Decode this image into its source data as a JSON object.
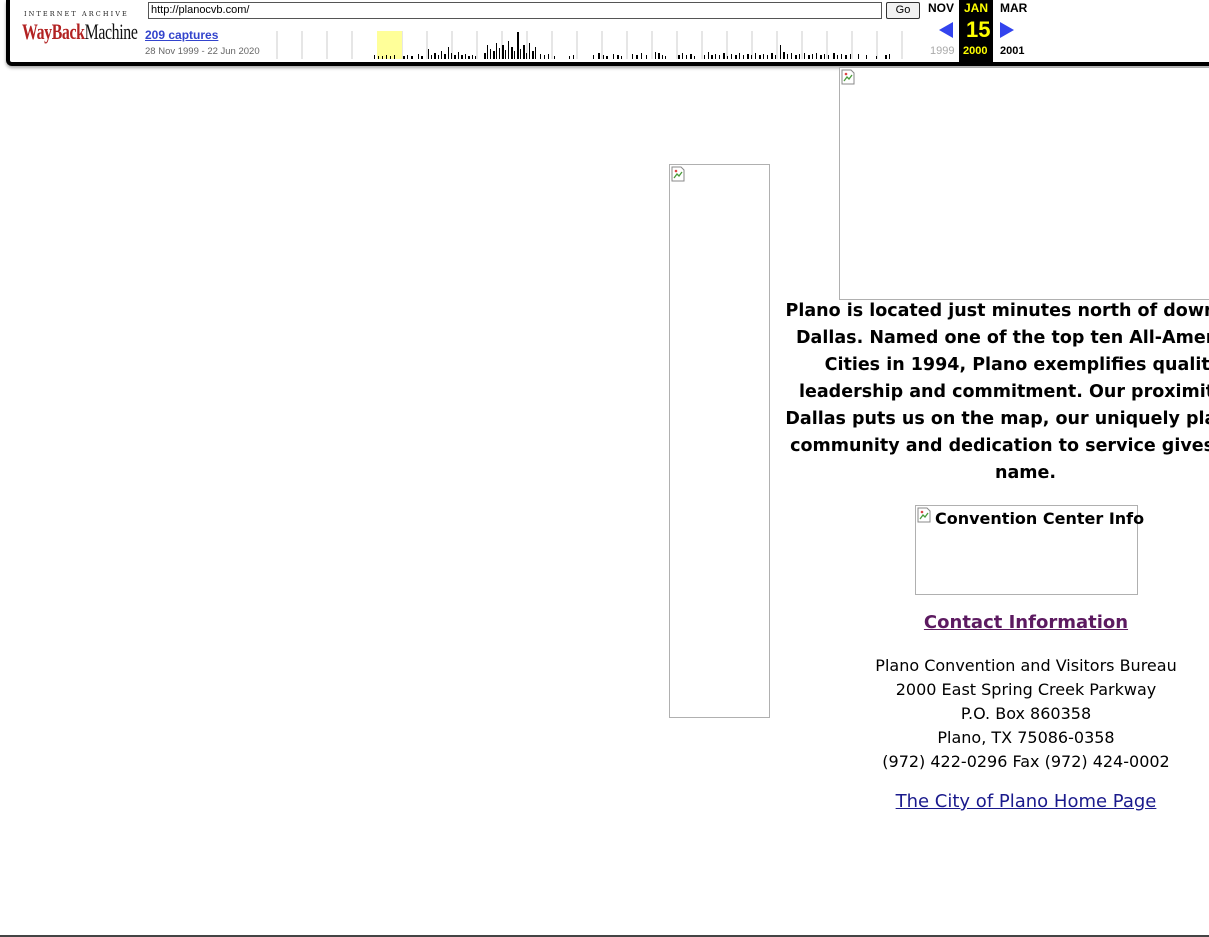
{
  "toolbar": {
    "logo_top": "INTERNET ARCHIVE",
    "logo_wayback_red": "WayBack",
    "logo_wayback_black": "Machine",
    "url_value": "http://planocvb.com/",
    "go_label": "Go",
    "captures_label": "209 captures",
    "date_range": "28 Nov 1999 - 22 Jun 2020",
    "prev_month": "NOV",
    "current_month": "JAN",
    "next_month": "MAR",
    "current_day": "15",
    "prev_year": "1999",
    "current_year": "2000",
    "next_year": "2001",
    "highlight_color": "#ffff99",
    "arrow_color": "#3344ee"
  },
  "page": {
    "intro_text": "Plano is located just minutes north of downtown\nDallas. Named one of the top ten All-American\nCities in 1994, Plano exemplifies quality,\nleadership and commitment. Our proximity to\nDallas puts us on the map, our uniquely planned\ncommunity and dedication to service gives us a\nname.",
    "convention_alt": "Convention Center Info",
    "contact_link": "Contact Information",
    "address": {
      "org": "Plano Convention and Visitors Bureau",
      "street": "2000 East Spring Creek Parkway",
      "po_box": "P.O. Box 860358",
      "city": "Plano, TX 75086-0358",
      "phones": "(972) 422-0296 Fax (972) 424-0002"
    },
    "city_link": "The City of Plano Home Page",
    "link_color_visited": "#5c1a60",
    "link_color": "#1a1a8c"
  }
}
